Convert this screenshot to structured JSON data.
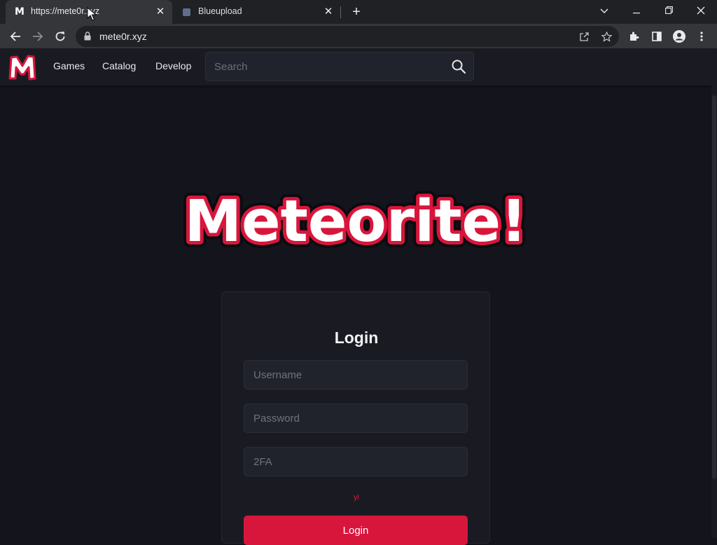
{
  "browser": {
    "tabs": [
      {
        "title": "https://mete0r.xyz",
        "active": true,
        "favicon": "M"
      },
      {
        "title": "Blueupload",
        "active": false
      }
    ],
    "new_tab_label": "+",
    "url": "mete0r.xyz",
    "window_controls": {
      "minimize": "—",
      "maximize": "❐",
      "close": "✕",
      "tab_search": "⌄"
    }
  },
  "site": {
    "nav": {
      "links": [
        "Games",
        "Catalog",
        "Develop"
      ],
      "search_placeholder": "Search"
    },
    "brand_text": "Meteorite!",
    "login": {
      "title": "Login",
      "username_placeholder": "Username",
      "password_placeholder": "Password",
      "twofa_placeholder": "2FA",
      "error_text": "yi",
      "button_label": "Login"
    },
    "colors": {
      "accent": "#d8163c",
      "background": "#14151c",
      "surface": "#1a1b22",
      "input": "#21232c"
    }
  }
}
